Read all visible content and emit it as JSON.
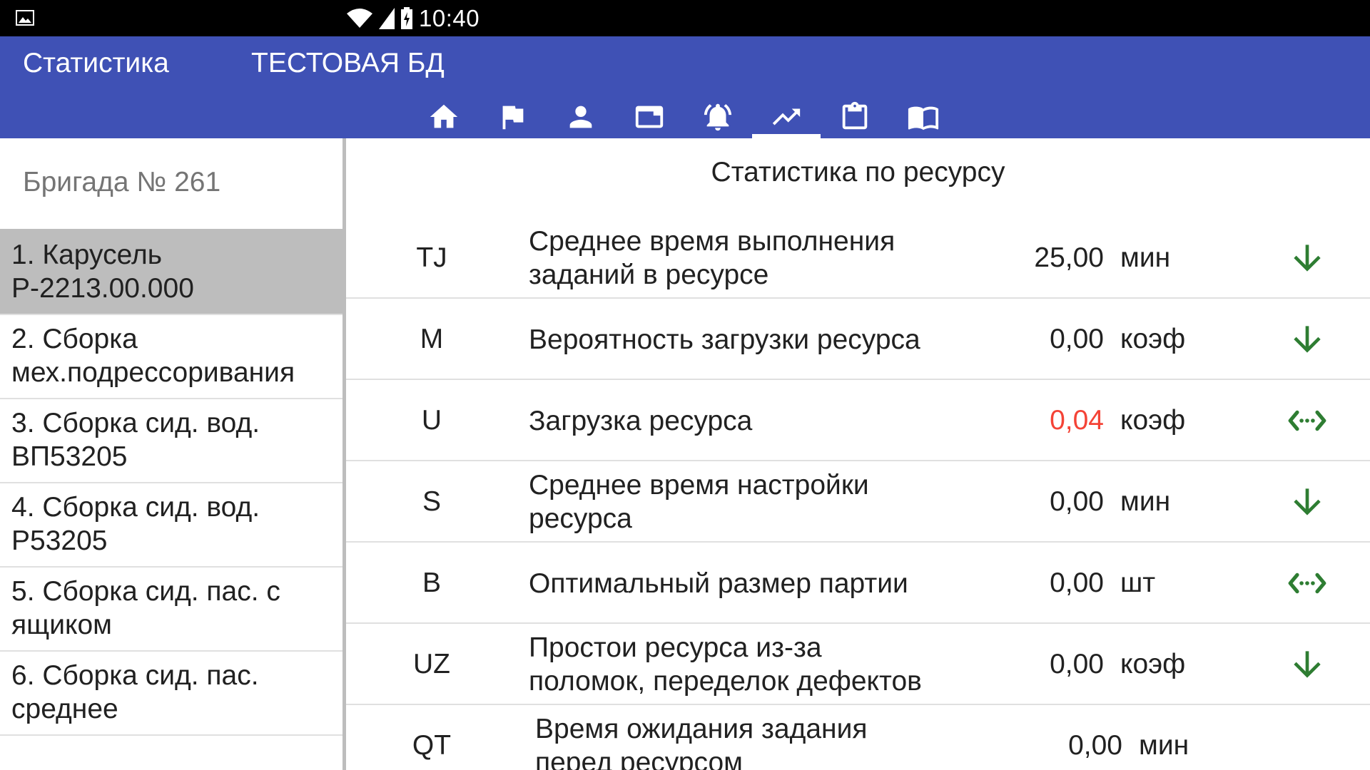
{
  "status_bar": {
    "time": "10:40"
  },
  "app_bar": {
    "title": "Статистика",
    "db_name": "ТЕСТОВАЯ БД",
    "tabs": [
      {
        "icon": "home-icon"
      },
      {
        "icon": "flag-icon"
      },
      {
        "icon": "person-icon"
      },
      {
        "icon": "window-icon"
      },
      {
        "icon": "alarm-icon"
      },
      {
        "icon": "trending-up-icon",
        "active": true
      },
      {
        "icon": "clipboard-icon"
      },
      {
        "icon": "book-icon"
      }
    ]
  },
  "sidebar": {
    "header": "Бригада № 261",
    "items": [
      {
        "line1": "1. Карусель",
        "line2": "Р-2213.00.000",
        "selected": true
      },
      {
        "line1": "2. Сборка",
        "line2": "мех.подрессоривания"
      },
      {
        "line1": "3. Сборка сид. вод.",
        "line2": "ВП53205"
      },
      {
        "line1": "4. Сборка сид. вод.",
        "line2": "Р53205"
      },
      {
        "line1": "5. Сборка сид. пас. с",
        "line2": "ящиком"
      },
      {
        "line1": "6. Сборка сид. пас.",
        "line2": "среднее"
      }
    ]
  },
  "main": {
    "heading": "Статистика по ресурсу",
    "rows": [
      {
        "code": "TJ",
        "label_line1": "Среднее время выполнения",
        "label_line2": "заданий в ресурсе",
        "value": "25,00",
        "unit": "мин",
        "trend": "down"
      },
      {
        "code": "M",
        "label_line1": "Вероятность загрузки ресурса",
        "label_line2": "",
        "value": "0,00",
        "unit": "коэф",
        "trend": "down"
      },
      {
        "code": "U",
        "label_line1": "Загрузка ресурса",
        "label_line2": "",
        "value": "0,04",
        "unit": "коэф",
        "trend": "both",
        "value_color": "#f44336"
      },
      {
        "code": "S",
        "label_line1": "Среднее время настройки",
        "label_line2": "ресурса",
        "value": "0,00",
        "unit": "мин",
        "trend": "down"
      },
      {
        "code": "B",
        "label_line1": "Оптимальный размер партии",
        "label_line2": "",
        "value": "0,00",
        "unit": "шт",
        "trend": "both"
      },
      {
        "code": "UZ",
        "label_line1": "Простои ресурса из-за",
        "label_line2": "поломок, переделок дефектов",
        "value": "0,00",
        "unit": "коэф",
        "trend": "down"
      },
      {
        "code": "QT",
        "label_line1": "Время ожидания задания",
        "label_line2": "перед ресурсом",
        "value": "0,00",
        "unit": "мин",
        "trend": ""
      }
    ]
  },
  "colors": {
    "primary": "#3f51b5",
    "trend_green": "#2e7d32",
    "alert_red": "#f44336",
    "selected_bg": "#bdbdbd"
  }
}
